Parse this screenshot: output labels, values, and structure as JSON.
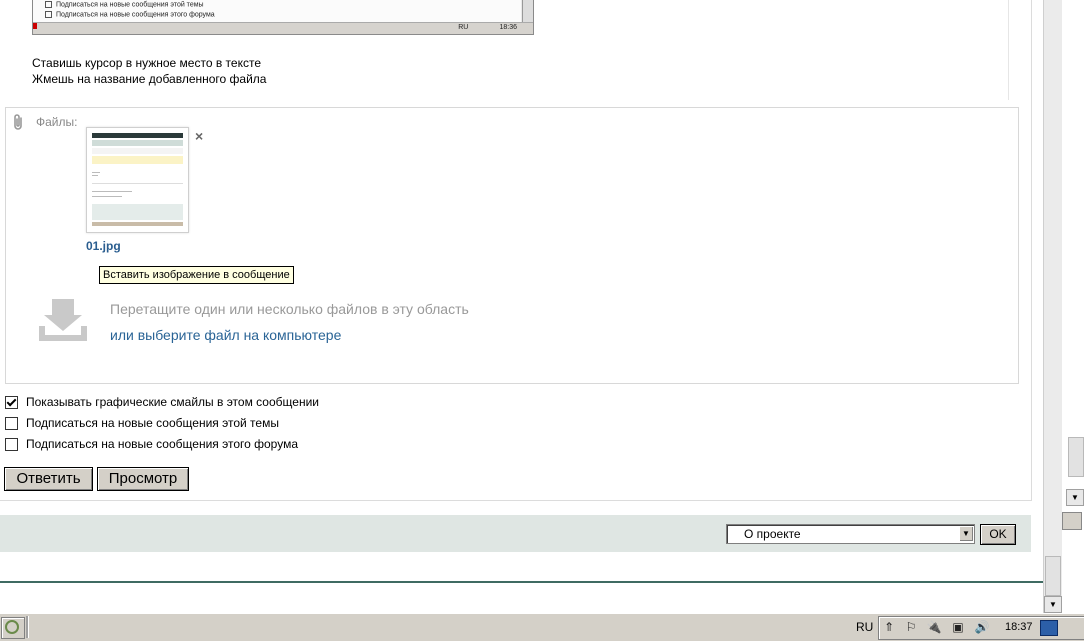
{
  "embedded_screenshot": {
    "lines": [
      "Подписаться на новые сообщения этой темы",
      "Подписаться на новые сообщения этого форума"
    ],
    "taskbar_lang": "RU",
    "taskbar_time": "18:36"
  },
  "message": {
    "line1": "Ставишь курсор в нужное место в тексте",
    "line2": "Жмешь на название добавленного файла"
  },
  "attachments": {
    "label": "Файлы:",
    "file_name": "01.jpg",
    "remove_glyph": "×",
    "tooltip": "Вставить изображение в сообщение",
    "drop_text": "Перетащите один или несколько файлов в эту область",
    "choose_link": "или выберите файл на компьютере"
  },
  "options": [
    {
      "label": "Показывать графические смайлы в этом сообщении",
      "checked": true
    },
    {
      "label": "Подписаться на новые сообщения этой темы",
      "checked": false
    },
    {
      "label": "Подписаться на новые сообщения этого форума",
      "checked": false
    }
  ],
  "buttons": {
    "reply": "Ответить",
    "preview": "Просмотр"
  },
  "jump": {
    "selected": "О проекте",
    "ok": "OK"
  },
  "taskbar": {
    "lang": "RU",
    "time": "18:37"
  },
  "icons": {
    "arrow_down": "▼",
    "tray": [
      "⇑",
      "⚐",
      "🔌",
      "▣",
      "🔊"
    ]
  }
}
